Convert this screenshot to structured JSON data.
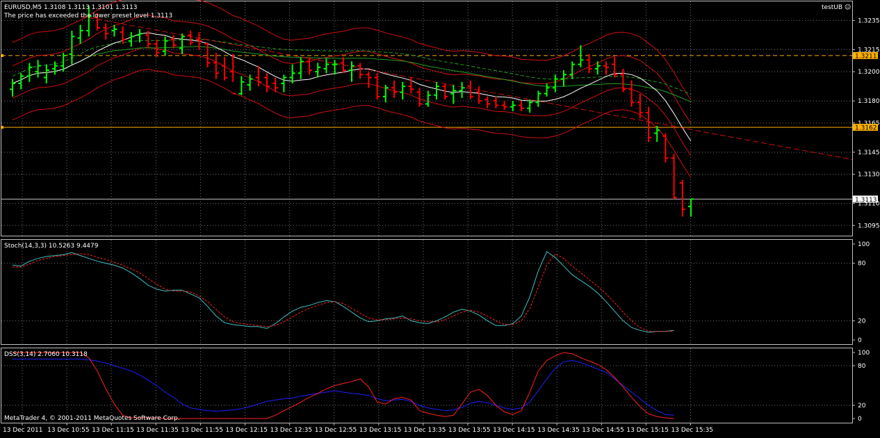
{
  "header": {
    "symbol_line": "EURUSD,M5  1.3108 1.3113 1.3101 1.3113",
    "alert_text": "The price has exceeded the lower preset level 1.3113",
    "expert_label": "testUB ☺"
  },
  "footer": {
    "copyright": "MetaTrader 4, © 2001-2011 MetaQuotes Software Corp."
  },
  "colors": {
    "background": "#000000",
    "grid": "#c0c0c0",
    "bull": "#00ff00",
    "bear": "#ff0000",
    "level_line": "#ffb000",
    "stoch_main": "#40c0c0",
    "stoch_signal": "#ff2020",
    "dss_1": "#ff2020",
    "dss_2": "#2020ff",
    "ma_white": "#ffffff",
    "ma_green": "#20a020",
    "envelope": "#d01010"
  },
  "price_axis": {
    "ticks": [
      "1.3235",
      "1.3215",
      "1.3200",
      "1.3180",
      "1.3165",
      "1.3145",
      "1.3130",
      "1.3110",
      "1.3095"
    ],
    "badges": [
      {
        "name": "upper-level",
        "label": "1.3211",
        "price": 1.3211,
        "style": "level"
      },
      {
        "name": "middle-level",
        "label": "1.3162",
        "price": 1.3162,
        "style": "level"
      },
      {
        "name": "current-price",
        "label": "1.3113",
        "price": 1.3113,
        "style": "bid"
      }
    ]
  },
  "stoch_panel": {
    "label": "Stoch(14,3,3) 10.5263 9.4479",
    "ticks": [
      "100",
      "80",
      "20",
      "0"
    ],
    "main": [
      78,
      77,
      82,
      85,
      87,
      88,
      89,
      91,
      88,
      85,
      82,
      80,
      78,
      75,
      70,
      64,
      57,
      53,
      51,
      52,
      52,
      48,
      44,
      35,
      25,
      18,
      16,
      15,
      14,
      14,
      12,
      17,
      24,
      30,
      34,
      36,
      39,
      41,
      40,
      35,
      29,
      23,
      19,
      20,
      22,
      23,
      25,
      20,
      18,
      17,
      20,
      24,
      29,
      32,
      30,
      26,
      20,
      15,
      15,
      17,
      25,
      45,
      72,
      92,
      86,
      77,
      68,
      62,
      56,
      49,
      40,
      30,
      20,
      13,
      10,
      8,
      9,
      9,
      10
    ],
    "signal": [
      76,
      76,
      79,
      83,
      85,
      87,
      88,
      89,
      90,
      89,
      86,
      84,
      81,
      78,
      74,
      70,
      64,
      58,
      53,
      51,
      51,
      50,
      46,
      40,
      32,
      24,
      19,
      17,
      16,
      15,
      14,
      15,
      19,
      24,
      29,
      33,
      36,
      39,
      40,
      38,
      33,
      28,
      23,
      21,
      21,
      22,
      23,
      22,
      20,
      19,
      19,
      21,
      25,
      29,
      31,
      29,
      25,
      20,
      16,
      16,
      20,
      33,
      55,
      78,
      90,
      85,
      77,
      70,
      63,
      56,
      48,
      39,
      29,
      20,
      13,
      9,
      9,
      9,
      9
    ]
  },
  "dss_panel": {
    "label": "DSS(3,14) 2.7060 10.3118",
    "ticks": [
      "100",
      "80",
      "20",
      "0"
    ],
    "red": [
      100,
      100,
      100,
      100,
      100,
      100,
      100,
      100,
      100,
      92,
      72,
      45,
      22,
      5,
      1,
      1,
      1,
      1,
      0,
      0,
      0,
      0,
      0,
      0,
      0,
      0,
      0,
      0,
      0,
      0,
      0,
      5,
      12,
      18,
      25,
      32,
      38,
      45,
      50,
      53,
      56,
      60,
      48,
      25,
      22,
      30,
      32,
      28,
      12,
      8,
      5,
      3,
      5,
      22,
      40,
      44,
      35,
      20,
      10,
      6,
      12,
      40,
      72,
      88,
      95,
      100,
      98,
      92,
      87,
      82,
      74,
      62,
      48,
      32,
      18,
      7,
      3,
      1,
      0
    ],
    "blue": [
      90,
      90,
      90,
      90,
      90,
      90,
      90,
      90,
      90,
      89,
      87,
      84,
      80,
      76,
      72,
      66,
      58,
      50,
      40,
      32,
      22,
      16,
      14,
      12,
      11,
      12,
      13,
      15,
      18,
      22,
      26,
      28,
      30,
      31,
      34,
      36,
      38,
      40,
      42,
      40,
      38,
      37,
      35,
      30,
      27,
      28,
      29,
      26,
      20,
      16,
      14,
      12,
      13,
      17,
      23,
      26,
      24,
      20,
      16,
      14,
      16,
      25,
      42,
      60,
      76,
      86,
      88,
      85,
      80,
      75,
      70,
      60,
      50,
      40,
      30,
      20,
      12,
      6,
      5
    ]
  },
  "time_axis": {
    "labels": [
      "13 Dec 2011",
      "13 Dec 10:55",
      "13 Dec 11:15",
      "13 Dec 11:35",
      "13 Dec 11:55",
      "13 Dec 12:15",
      "13 Dec 12:35",
      "13 Dec 12:55",
      "13 Dec 13:15",
      "13 Dec 13:35",
      "13 Dec 13:55",
      "13 Dec 14:15",
      "13 Dec 14:35",
      "13 Dec 14:55",
      "13 Dec 15:15",
      "13 Dec 15:35"
    ]
  },
  "chart_data": {
    "type": "candlestick-bars",
    "symbol": "EURUSD",
    "timeframe": "M5",
    "ylim": [
      1.3088,
      1.3248
    ],
    "ohlc": [
      [
        1.3188,
        1.3195,
        1.3183,
        1.3192
      ],
      [
        1.3192,
        1.3199,
        1.3188,
        1.3197
      ],
      [
        1.3197,
        1.3206,
        1.3193,
        1.3203
      ],
      [
        1.32,
        1.3208,
        1.3196,
        1.3204
      ],
      [
        1.3196,
        1.3205,
        1.3192,
        1.3201
      ],
      [
        1.3202,
        1.3207,
        1.3198,
        1.3204
      ],
      [
        1.3204,
        1.3213,
        1.32,
        1.3211
      ],
      [
        1.3212,
        1.3228,
        1.3205,
        1.3224
      ],
      [
        1.3223,
        1.3232,
        1.3219,
        1.3228
      ],
      [
        1.3228,
        1.3245,
        1.3224,
        1.3238
      ],
      [
        1.3237,
        1.324,
        1.3228,
        1.323
      ],
      [
        1.323,
        1.3233,
        1.3222,
        1.3226
      ],
      [
        1.3228,
        1.3232,
        1.3224,
        1.3229
      ],
      [
        1.3227,
        1.3231,
        1.3219,
        1.3222
      ],
      [
        1.3221,
        1.3227,
        1.3217,
        1.3224
      ],
      [
        1.3225,
        1.3229,
        1.322,
        1.3226
      ],
      [
        1.3225,
        1.3228,
        1.3216,
        1.3219
      ],
      [
        1.3219,
        1.3222,
        1.321,
        1.3213
      ],
      [
        1.3214,
        1.3224,
        1.3211,
        1.3221
      ],
      [
        1.3222,
        1.3225,
        1.3216,
        1.3218
      ],
      [
        1.3216,
        1.3226,
        1.3212,
        1.3224
      ],
      [
        1.3225,
        1.3228,
        1.3218,
        1.322
      ],
      [
        1.3222,
        1.3227,
        1.3215,
        1.3221
      ],
      [
        1.3219,
        1.322,
        1.3203,
        1.3206
      ],
      [
        1.3206,
        1.3213,
        1.3195,
        1.3199
      ],
      [
        1.3204,
        1.321,
        1.3194,
        1.3196
      ],
      [
        1.32,
        1.3212,
        1.3193,
        1.3185
      ],
      [
        1.3185,
        1.3197,
        1.3184,
        1.3193
      ],
      [
        1.3191,
        1.3198,
        1.3187,
        1.3195
      ],
      [
        1.3196,
        1.3204,
        1.319,
        1.3193
      ],
      [
        1.3196,
        1.3199,
        1.3186,
        1.319
      ],
      [
        1.3192,
        1.3196,
        1.3186,
        1.3189
      ],
      [
        1.3192,
        1.3198,
        1.3186,
        1.3196
      ],
      [
        1.3196,
        1.3205,
        1.3192,
        1.3199
      ],
      [
        1.3199,
        1.321,
        1.3195,
        1.3207
      ],
      [
        1.3207,
        1.321,
        1.3198,
        1.3201
      ],
      [
        1.32,
        1.3206,
        1.3196,
        1.3203
      ],
      [
        1.3202,
        1.3209,
        1.3199,
        1.3205
      ],
      [
        1.3205,
        1.3208,
        1.3198,
        1.3205
      ],
      [
        1.3206,
        1.321,
        1.3199,
        1.3201
      ],
      [
        1.3201,
        1.3207,
        1.3193,
        1.3204
      ],
      [
        1.3204,
        1.3206,
        1.3195,
        1.3198
      ],
      [
        1.3198,
        1.32,
        1.3189,
        1.3196
      ],
      [
        1.3196,
        1.3199,
        1.3181,
        1.3183
      ],
      [
        1.3183,
        1.3191,
        1.3179,
        1.3189
      ],
      [
        1.3189,
        1.3194,
        1.3182,
        1.3186
      ],
      [
        1.3186,
        1.3193,
        1.3181,
        1.319
      ],
      [
        1.319,
        1.3196,
        1.3185,
        1.3188
      ],
      [
        1.3186,
        1.3189,
        1.3176,
        1.3178
      ],
      [
        1.3178,
        1.3187,
        1.3176,
        1.3184
      ],
      [
        1.3184,
        1.3193,
        1.3181,
        1.319
      ],
      [
        1.319,
        1.3192,
        1.3181,
        1.3183
      ],
      [
        1.3185,
        1.3191,
        1.3178,
        1.3187
      ],
      [
        1.3187,
        1.3193,
        1.3182,
        1.3189
      ],
      [
        1.319,
        1.3194,
        1.3181,
        1.3183
      ],
      [
        1.3186,
        1.319,
        1.3178,
        1.318
      ],
      [
        1.3181,
        1.3183,
        1.3175,
        1.3178
      ],
      [
        1.318,
        1.3183,
        1.3175,
        1.3177
      ],
      [
        1.3177,
        1.318,
        1.3174,
        1.3176
      ],
      [
        1.3176,
        1.318,
        1.3173,
        1.3177
      ],
      [
        1.3177,
        1.318,
        1.3173,
        1.3175
      ],
      [
        1.3175,
        1.3181,
        1.3172,
        1.3179
      ],
      [
        1.3179,
        1.3187,
        1.3176,
        1.3185
      ],
      [
        1.3185,
        1.3192,
        1.3183,
        1.3189
      ],
      [
        1.3189,
        1.3198,
        1.3186,
        1.3195
      ],
      [
        1.3195,
        1.3201,
        1.319,
        1.3198
      ],
      [
        1.3198,
        1.3207,
        1.3195,
        1.3205
      ],
      [
        1.3205,
        1.3218,
        1.3203,
        1.3208
      ],
      [
        1.3208,
        1.3212,
        1.3199,
        1.3202
      ],
      [
        1.3202,
        1.3207,
        1.3198,
        1.3204
      ],
      [
        1.3204,
        1.3207,
        1.3198,
        1.3203
      ],
      [
        1.3205,
        1.321,
        1.3196,
        1.3198
      ],
      [
        1.3198,
        1.3202,
        1.3186,
        1.3188
      ],
      [
        1.3188,
        1.3194,
        1.3176,
        1.3179
      ],
      [
        1.3179,
        1.3185,
        1.3168,
        1.3172
      ],
      [
        1.3172,
        1.3176,
        1.3152,
        1.3155
      ],
      [
        1.3158,
        1.3163,
        1.3152,
        1.316
      ],
      [
        1.3156,
        1.3158,
        1.3138,
        1.3141
      ],
      [
        1.3141,
        1.3144,
        1.3113,
        1.3114
      ],
      [
        1.3124,
        1.3126,
        1.3101,
        1.3106
      ],
      [
        1.3108,
        1.3113,
        1.3101,
        1.3113
      ]
    ],
    "indicators": {
      "ma_white_label": "MA",
      "envelope_label": "Envelopes"
    }
  }
}
